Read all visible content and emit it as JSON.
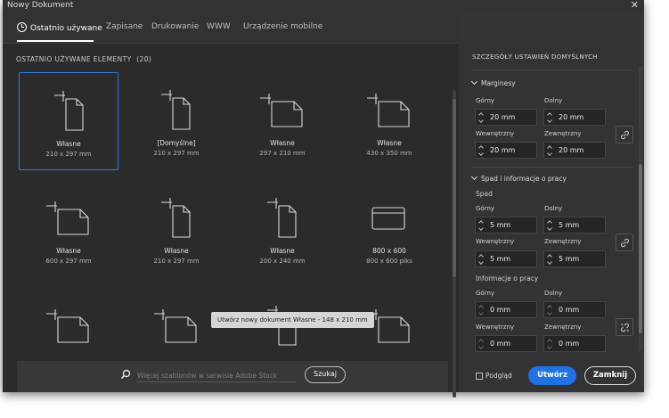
{
  "window": {
    "title": "Nowy Dokument",
    "close_glyph": "✕"
  },
  "tabs": [
    {
      "label": "Ostatnio używane",
      "active": true
    },
    {
      "label": "Zapisane"
    },
    {
      "label": "Drukowanie"
    },
    {
      "label": "WWW"
    },
    {
      "label": "Urządzenie mobilne"
    }
  ],
  "recent": {
    "heading": "OSTATNIO UŻYWANE ELEMENTY",
    "count": "(20)",
    "items": [
      {
        "name": "Własne",
        "size": "210 x 297 mm",
        "icon": "portrait-document-icon",
        "selected": true
      },
      {
        "name": "[Domyślne]",
        "size": "210 x 297 mm",
        "icon": "portrait-document-icon"
      },
      {
        "name": "Własne",
        "size": "297 x 210 mm",
        "icon": "landscape-document-icon"
      },
      {
        "name": "Własne",
        "size": "430 x 350 mm",
        "icon": "landscape-document-icon"
      },
      {
        "name": "Własne",
        "size": "600 x 297 mm",
        "icon": "landscape-document-icon"
      },
      {
        "name": "Własne",
        "size": "210 x 297 mm",
        "icon": "portrait-document-icon"
      },
      {
        "name": "Własne",
        "size": "200 x 240 mm",
        "icon": "portrait-document-icon"
      },
      {
        "name": "800 x 600",
        "size": "800 x 600 piks",
        "icon": "web-document-icon"
      },
      {
        "name": "",
        "size": "",
        "icon": "landscape-document-icon"
      },
      {
        "name": "",
        "size": "",
        "icon": "landscape-document-icon"
      },
      {
        "name": "",
        "size": "",
        "icon": "portrait-document-icon"
      },
      {
        "name": "",
        "size": "",
        "icon": "landscape-document-icon"
      }
    ],
    "tooltip": "Utwórz nowy dokument Własne - 148 x 210 mm"
  },
  "search": {
    "placeholder": "Więcej szablonów w serwisie Adobe Stock",
    "button": "Szukaj"
  },
  "settings": {
    "title": "SZCZEGÓŁY USTAWIEŃ DOMYŚLNYCH",
    "margins": {
      "heading": "Marginesy",
      "top_label": "Górny",
      "top": "20 mm",
      "bottom_label": "Dolny",
      "bottom": "20 mm",
      "inner_label": "Wewnętrzny",
      "inner": "20 mm",
      "outer_label": "Zewnętrzny",
      "outer": "20 mm"
    },
    "bleed_slug": {
      "heading": "Spad i informacje o pracy",
      "bleed_label": "Spad",
      "bleed": {
        "top_label": "Górny",
        "top": "5 mm",
        "bottom_label": "Dolny",
        "bottom": "5 mm",
        "inner_label": "Wewnętrzny",
        "inner": "5 mm",
        "outer_label": "Zewnętrzny",
        "outer": "5 mm"
      },
      "slug_label": "Informacje o pracy",
      "slug": {
        "top_label": "Górny",
        "top": "0 mm",
        "bottom_label": "Dolny",
        "bottom": "0 mm",
        "inner_label": "Wewnętrzny",
        "inner": "0 mm",
        "outer_label": "Zewnętrzny",
        "outer": "0 mm"
      }
    }
  },
  "footer": {
    "preview_label": "Podgląd",
    "create_button": "Utwórz",
    "close_button": "Zamknij",
    "accent_color": "#1f73e6"
  }
}
